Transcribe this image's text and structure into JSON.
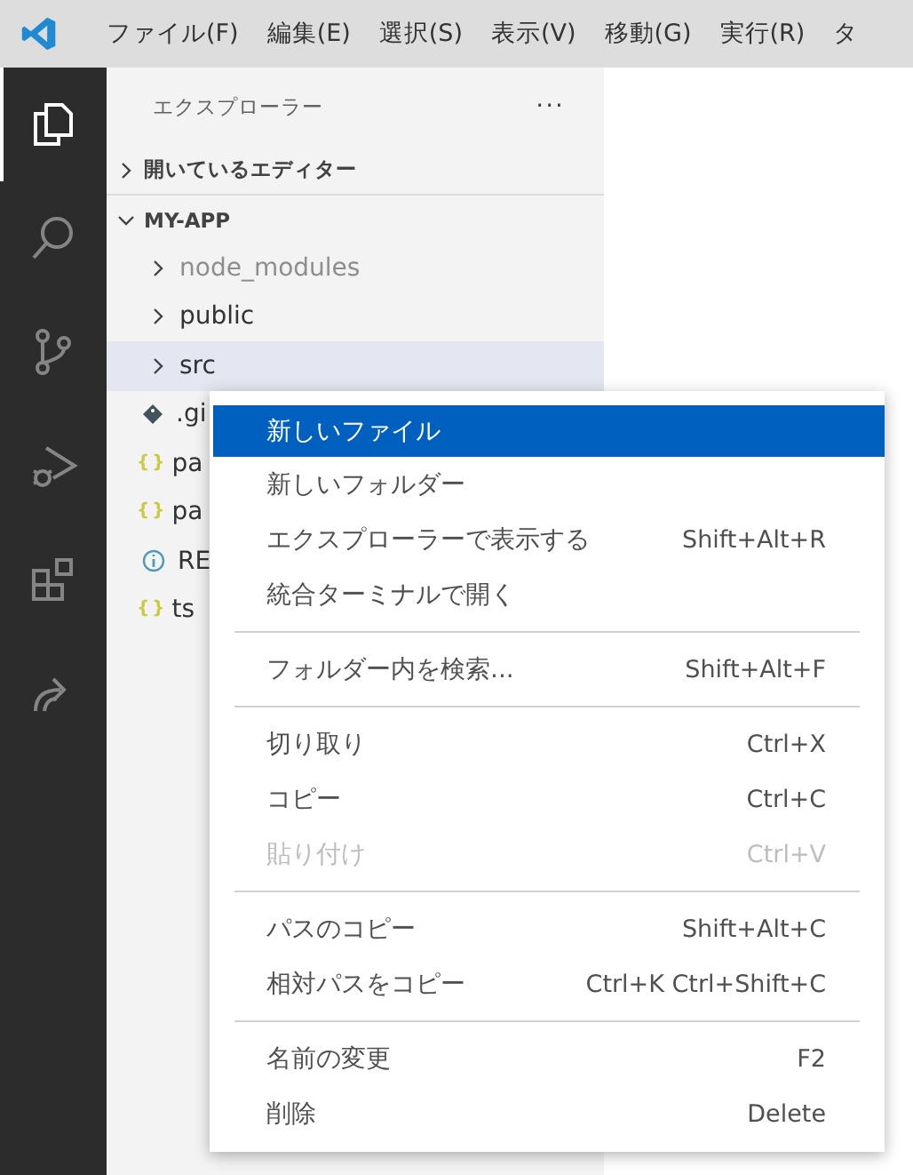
{
  "menu_bar": [
    {
      "label": "ファイル(F)"
    },
    {
      "label": "編集(E)"
    },
    {
      "label": "選択(S)"
    },
    {
      "label": "表示(V)"
    },
    {
      "label": "移動(G)"
    },
    {
      "label": "実行(R)"
    },
    {
      "label": "タ"
    }
  ],
  "activity_bar": [
    {
      "kind": "explorer",
      "selected": true
    },
    {
      "kind": "search",
      "selected": false
    },
    {
      "kind": "source-control",
      "selected": false
    },
    {
      "kind": "debug",
      "selected": false
    },
    {
      "kind": "extensions",
      "selected": false
    },
    {
      "kind": "share",
      "selected": false
    }
  ],
  "sidebar": {
    "title": "エクスプローラー",
    "more": "···",
    "sections": [
      {
        "label": "開いているエディター",
        "expanded": false
      },
      {
        "label": "MY-APP",
        "expanded": true,
        "children": [
          {
            "label": "node_modules",
            "kind": "folder",
            "expanded": false,
            "dimmed": true,
            "selected": false
          },
          {
            "label": "public",
            "kind": "folder",
            "expanded": false,
            "dimmed": false,
            "selected": false
          },
          {
            "label": "src",
            "kind": "folder",
            "expanded": false,
            "dimmed": false,
            "selected": true
          },
          {
            "label": ".gi",
            "kind": "git",
            "dimmed": false,
            "selected": false
          },
          {
            "label": "pa",
            "kind": "json",
            "icon": "{ }",
            "dimmed": false,
            "selected": false
          },
          {
            "label": "pa",
            "kind": "json",
            "icon": "{ }",
            "dimmed": false,
            "selected": false
          },
          {
            "label": "RE",
            "kind": "info",
            "dimmed": false,
            "selected": false
          },
          {
            "label": "ts",
            "kind": "json",
            "icon": "{ }",
            "dimmed": false,
            "selected": false
          }
        ]
      }
    ]
  },
  "context_menu": {
    "groups": [
      [
        {
          "label": "新しいファイル",
          "selected": true,
          "disabled": false
        },
        {
          "label": "新しいフォルダー",
          "selected": false,
          "disabled": false
        },
        {
          "label": "エクスプローラーで表示する",
          "shortcut": "Shift+Alt+R",
          "selected": false,
          "disabled": false
        },
        {
          "label": "統合ターミナルで開く",
          "selected": false,
          "disabled": false
        }
      ],
      [
        {
          "label": "フォルダー内を検索...",
          "shortcut": "Shift+Alt+F",
          "selected": false,
          "disabled": false
        }
      ],
      [
        {
          "label": "切り取り",
          "shortcut": "Ctrl+X",
          "selected": false,
          "disabled": false
        },
        {
          "label": "コピー",
          "shortcut": "Ctrl+C",
          "selected": false,
          "disabled": false
        },
        {
          "label": "貼り付け",
          "shortcut": "Ctrl+V",
          "selected": false,
          "disabled": true
        }
      ],
      [
        {
          "label": "パスのコピー",
          "shortcut": "Shift+Alt+C",
          "selected": false,
          "disabled": false
        },
        {
          "label": "相対パスをコピー",
          "shortcut": "Ctrl+K Ctrl+Shift+C",
          "selected": false,
          "disabled": false
        }
      ],
      [
        {
          "label": "名前の変更",
          "shortcut": "F2",
          "selected": false,
          "disabled": false
        },
        {
          "label": "削除",
          "shortcut": "Delete",
          "selected": false,
          "disabled": false
        }
      ]
    ]
  }
}
